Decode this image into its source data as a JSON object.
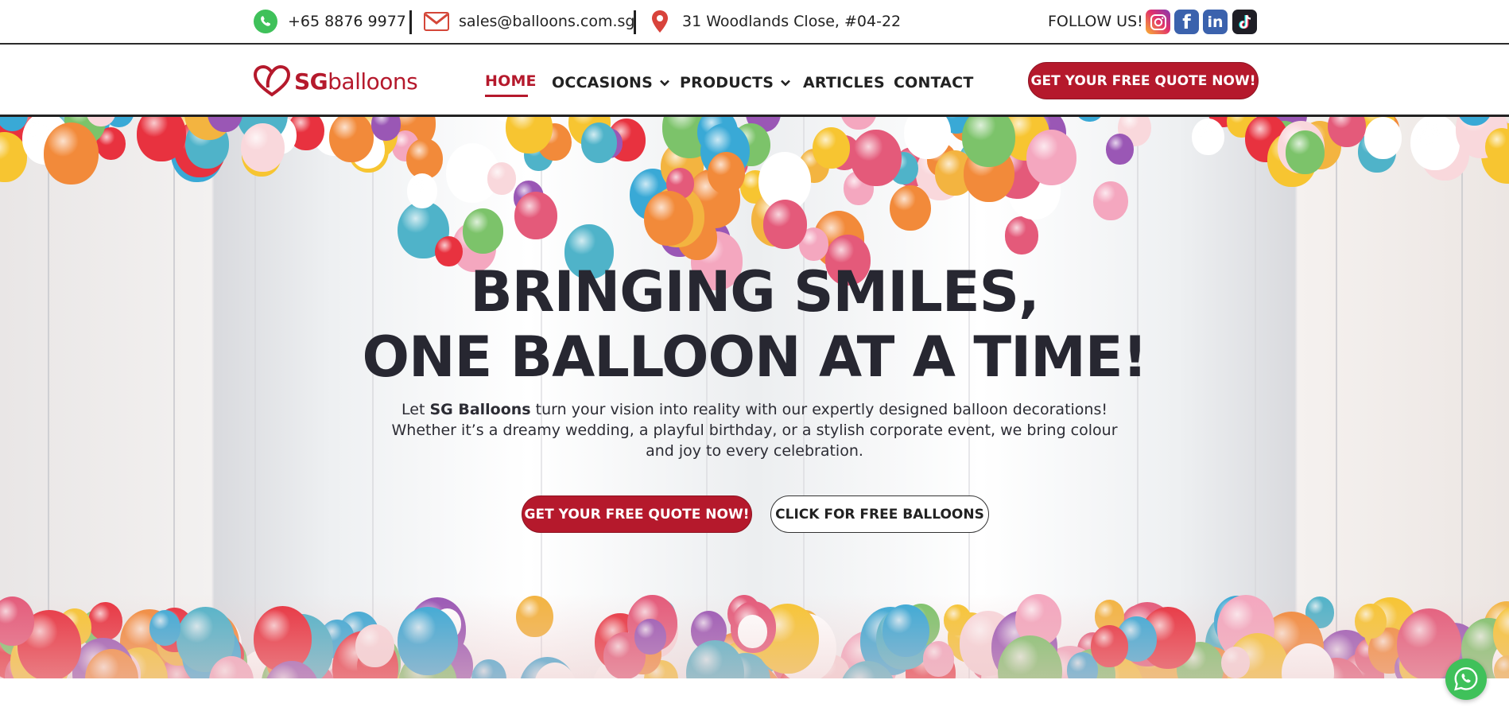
{
  "topbar": {
    "phone": "+65 8876 9977",
    "email": "sales@balloons.com.sg",
    "address": "31 Woodlands Close, #04-22",
    "follow_label": "FOLLOW US!",
    "socials": [
      "instagram-icon",
      "facebook-icon",
      "linkedin-icon",
      "tiktok-icon"
    ]
  },
  "brand": {
    "logo_prefix": "SG",
    "logo_suffix": "balloons",
    "accent_color": "#b5192c"
  },
  "nav": {
    "items": [
      {
        "label": "HOME",
        "active": true
      },
      {
        "label": "OCCASIONS",
        "dropdown": true
      },
      {
        "label": "PRODUCTS",
        "dropdown": true
      },
      {
        "label": "ARTICLES"
      },
      {
        "label": "CONTACT"
      }
    ],
    "cta": "GET YOUR FREE QUOTE NOW!"
  },
  "hero": {
    "headline_line1": "BRINGING SMILES,",
    "headline_line2": "ONE BALLOON AT A TIME!",
    "intro_before": "Let ",
    "intro_bold": "SG Balloons",
    "intro_after": " turn your vision into reality with our expertly designed balloon decorations! Whether it’s a dreamy wedding, a playful birthday, or a stylish corporate event, we bring colour and joy to every celebration.",
    "primary_button": "GET YOUR FREE QUOTE NOW!",
    "secondary_button": "CLICK FOR FREE BALLOONS"
  }
}
